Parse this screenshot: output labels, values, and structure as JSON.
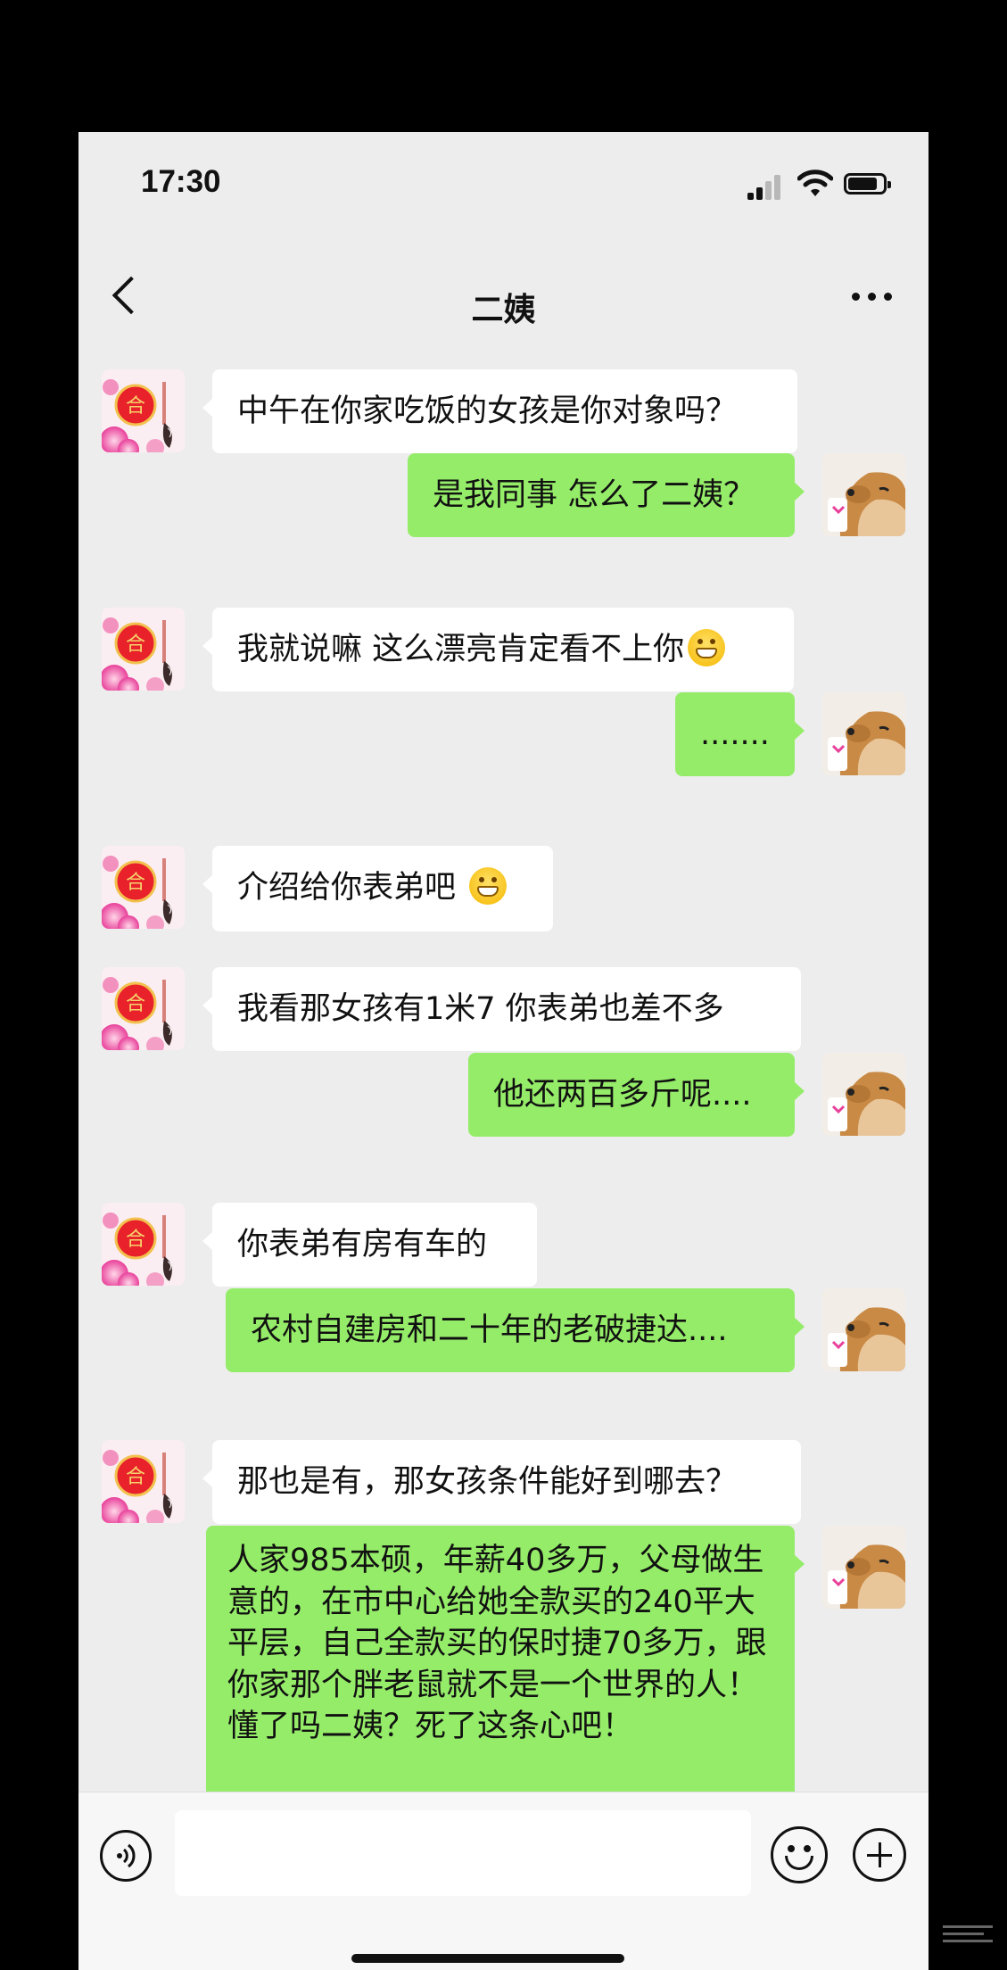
{
  "status_bar": {
    "time": "17:30",
    "icons": [
      "cellular-signal-icon",
      "wifi-icon",
      "battery-icon"
    ]
  },
  "header": {
    "title": "二姨",
    "back_icon": "chevron-left-icon",
    "more_icon": "more-dots-icon"
  },
  "messages": [
    {
      "side": "left",
      "text": "中午在你家吃饭的女孩是你对象吗？",
      "emoji": ""
    },
    {
      "side": "right",
      "text": "是我同事 怎么了二姨？",
      "emoji": ""
    },
    {
      "side": "left",
      "text": "我就说嘛 这么漂亮肯定看不上你",
      "emoji": "grinning-face"
    },
    {
      "side": "right",
      "text": ".......",
      "emoji": ""
    },
    {
      "side": "left",
      "text": "介绍给你表弟吧 ",
      "emoji": "grinning-face"
    },
    {
      "side": "left",
      "text": "我看那女孩有1米7 你表弟也差不多",
      "emoji": ""
    },
    {
      "side": "right",
      "text": "他还两百多斤呢....",
      "emoji": ""
    },
    {
      "side": "left",
      "text": "你表弟有房有车的",
      "emoji": ""
    },
    {
      "side": "right",
      "text": "农村自建房和二十年的老破捷达....",
      "emoji": ""
    },
    {
      "side": "left",
      "text": "那也是有，那女孩条件能好到哪去？",
      "emoji": ""
    },
    {
      "side": "right",
      "text": "人家985本硕，年薪40多万，父母做生意的，在市中心给她全款买的240平大平层，自己全款买的保时捷70多万，跟你家那个胖老鼠就不是一个世界的人！懂了吗二姨？死了这条心吧！",
      "emoji": ""
    }
  ],
  "input_bar": {
    "voice_icon": "voice-input-icon",
    "input_value": "",
    "emoji_icon": "emoji-icon",
    "plus_icon": "plus-icon"
  },
  "colors": {
    "background": "#ededed",
    "sent_bubble": "#95ec69",
    "received_bubble": "#ffffff"
  }
}
